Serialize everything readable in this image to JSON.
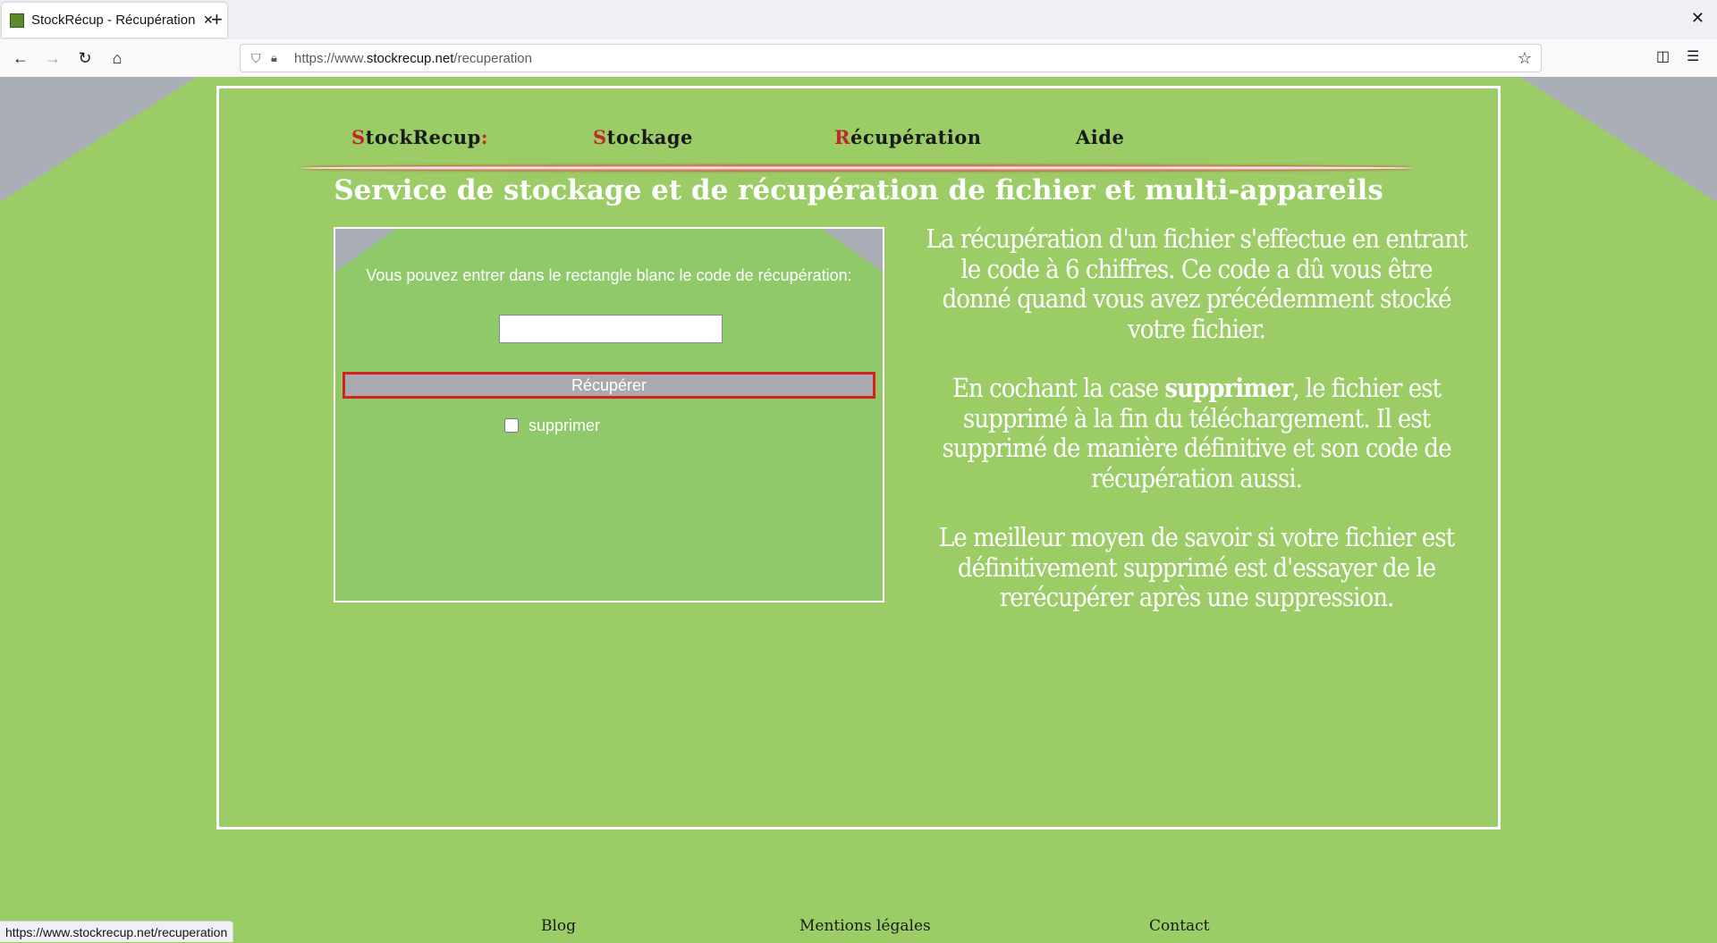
{
  "browser": {
    "tab_title": "StockRécup - Récupération",
    "url_prefix": "https://www.",
    "url_domain": "stockrecup.net",
    "url_path": "/recuperation",
    "status_url": "https://www.stockrecup.net/recuperation"
  },
  "menu": {
    "brand_first": "S",
    "brand_rest": "tockRecup",
    "brand_colon": ":",
    "storage_first": "S",
    "storage_rest": "tockage",
    "recovery_first": "R",
    "recovery_rest": "écupération",
    "help": "Aide"
  },
  "page_title": "Service de stockage et de récupération de fichier et multi-appareils",
  "form": {
    "instruction": "Vous pouvez entrer dans le rectangle blanc le code de récupération:",
    "code_value": "",
    "submit_label": "Récupérer",
    "delete_label": "supprimer",
    "delete_checked": false
  },
  "info": {
    "p1": "La récupération d'un fichier s'effectue en entrant le code à 6 chiffres. Ce code a dû vous être donné quand vous avez précédemment stocké votre fichier.",
    "p2_before": "En cochant la case ",
    "p2_bold": "supprimer",
    "p2_after": ", le fichier est supprimé à la fin du téléchargement. Il est supprimé de manière définitive et son code de récupération aussi.",
    "p3": "Le meilleur moyen de savoir si votre fichier est définitivement supprimé est d'essayer de le rerécupérer après une suppression."
  },
  "footer": {
    "blog": "Blog",
    "legal": "Mentions légales",
    "contact": "Contact"
  },
  "colors": {
    "background": "#9bcc66",
    "accent_red": "#c0282c",
    "corner_gray": "#a9aeb7"
  }
}
